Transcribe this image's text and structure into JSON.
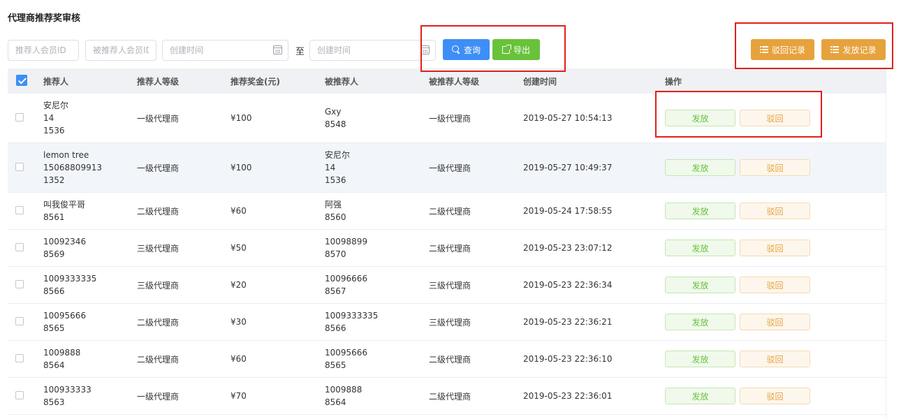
{
  "page": {
    "title": "代理商推荐奖审核"
  },
  "filters": {
    "referrer_id_placeholder": "推荐人会员ID",
    "referee_id_placeholder": "被推荐人会员ID",
    "start_time_placeholder": "创建时间",
    "separator": "至",
    "end_time_placeholder": "创建时间"
  },
  "buttons": {
    "search": "查询",
    "export": "导出",
    "reject_records": "驳回记录",
    "issue_records": "发放记录"
  },
  "table": {
    "headers": [
      "推荐人",
      "推荐人等级",
      "推荐奖金(元)",
      "被推荐人",
      "被推荐人等级",
      "创建时间",
      "操作"
    ],
    "action_issue": "发放",
    "action_reject": "驳回",
    "rows": [
      {
        "referrer": [
          "安尼尔",
          "14",
          "1536"
        ],
        "referrer_level": "一级代理商",
        "bonus": "¥100",
        "referee": [
          "Gxy",
          "8548"
        ],
        "referee_level": "一级代理商",
        "created": "2019-05-27 10:54:13"
      },
      {
        "referrer": [
          "lemon tree",
          "15068809913",
          "1352"
        ],
        "referrer_level": "一级代理商",
        "bonus": "¥100",
        "referee": [
          "安尼尔",
          "14",
          "1536"
        ],
        "referee_level": "一级代理商",
        "created": "2019-05-27 10:49:37"
      },
      {
        "referrer": [
          "叫我俊平哥",
          "8561"
        ],
        "referrer_level": "二级代理商",
        "bonus": "¥60",
        "referee": [
          "阿强",
          "8560"
        ],
        "referee_level": "二级代理商",
        "created": "2019-05-24 17:58:55"
      },
      {
        "referrer": [
          "10092346",
          "8569"
        ],
        "referrer_level": "三级代理商",
        "bonus": "¥50",
        "referee": [
          "10098899",
          "8570"
        ],
        "referee_level": "二级代理商",
        "created": "2019-05-23 23:07:12"
      },
      {
        "referrer": [
          "1009333335",
          "8566"
        ],
        "referrer_level": "三级代理商",
        "bonus": "¥20",
        "referee": [
          "10096666",
          "8567"
        ],
        "referee_level": "三级代理商",
        "created": "2019-05-23 22:36:34"
      },
      {
        "referrer": [
          "10095666",
          "8565"
        ],
        "referrer_level": "二级代理商",
        "bonus": "¥30",
        "referee": [
          "1009333335",
          "8566"
        ],
        "referee_level": "三级代理商",
        "created": "2019-05-23 22:36:21"
      },
      {
        "referrer": [
          "1009888",
          "8564"
        ],
        "referrer_level": "二级代理商",
        "bonus": "¥60",
        "referee": [
          "10095666",
          "8565"
        ],
        "referee_level": "二级代理商",
        "created": "2019-05-23 22:36:10"
      },
      {
        "referrer": [
          "100933333",
          "8563"
        ],
        "referrer_level": "一级代理商",
        "bonus": "¥70",
        "referee": [
          "1009888",
          "8564"
        ],
        "referee_level": "二级代理商",
        "created": "2019-05-23 22:36:01"
      }
    ]
  }
}
